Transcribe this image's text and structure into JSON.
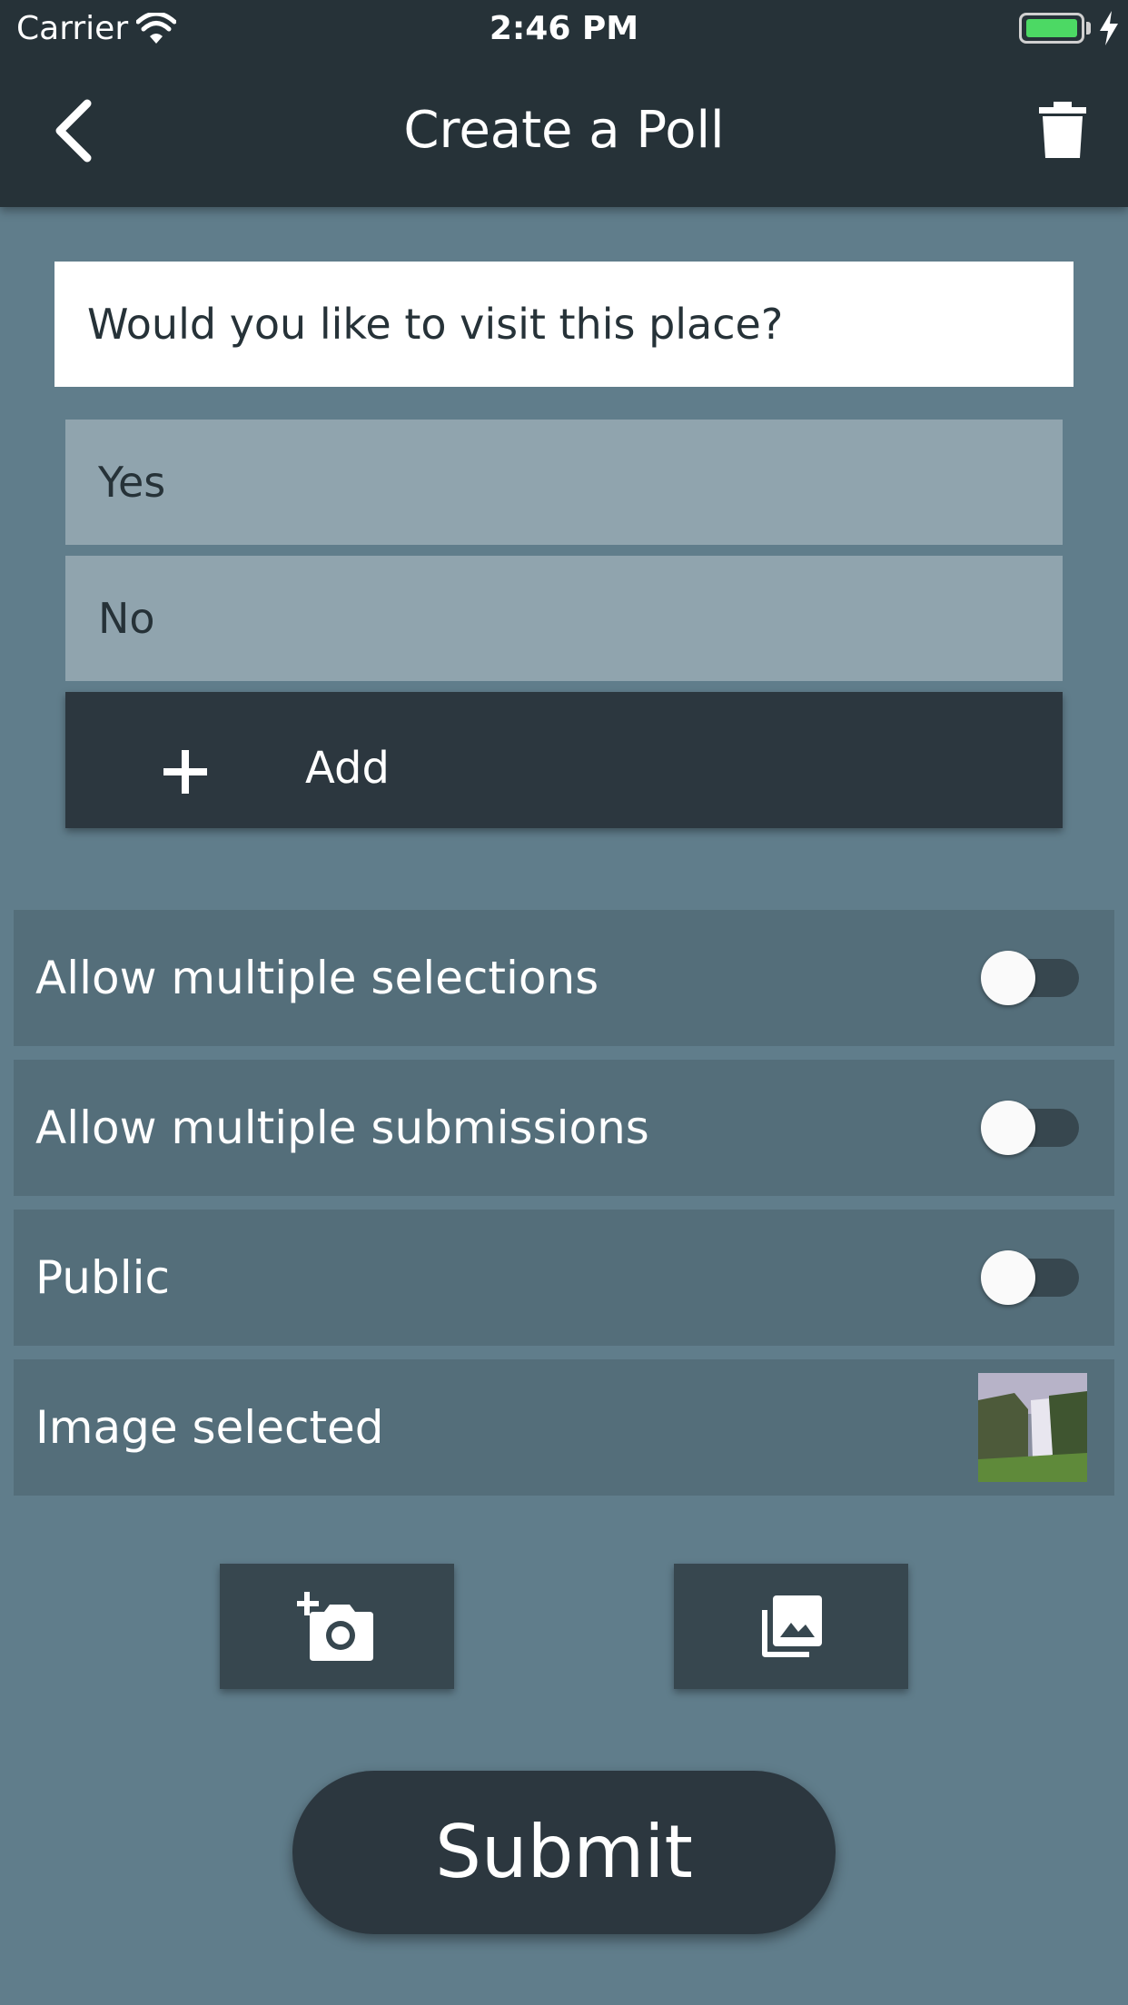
{
  "status_bar": {
    "carrier": "Carrier",
    "time": "2:46 PM",
    "battery_level": 1.0
  },
  "app_bar": {
    "title": "Create a Poll",
    "back_icon": "chevron-left-icon",
    "delete_icon": "trash-icon"
  },
  "question": {
    "value": "Would you like to visit this place?"
  },
  "options": [
    {
      "label": "Yes"
    },
    {
      "label": "No"
    }
  ],
  "add_option": {
    "label": "Add",
    "icon": "plus-icon"
  },
  "settings": [
    {
      "label": "Allow multiple selections",
      "enabled": false
    },
    {
      "label": "Allow multiple submissions",
      "enabled": false
    },
    {
      "label": "Public",
      "enabled": false
    }
  ],
  "image_row": {
    "label": "Image selected"
  },
  "media_buttons": {
    "camera_icon": "add-photo-icon",
    "gallery_icon": "photo-library-icon"
  },
  "submit": {
    "label": "Submit"
  },
  "colors": {
    "background": "#607d8b",
    "app_bar": "#263238",
    "option": "#90a4ae",
    "row": "#546e7a",
    "button": "#2c373f"
  }
}
